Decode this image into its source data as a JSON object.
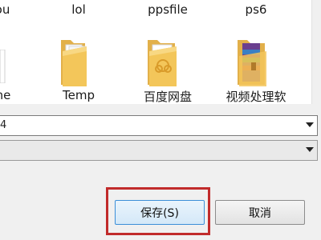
{
  "file_list": {
    "top_row": [
      "ou",
      "lol",
      "ppsfile",
      "ps6"
    ],
    "bottom_row": [
      "he",
      "Temp",
      "百度网盘",
      "视频处理软"
    ]
  },
  "fields": {
    "filename_value": "4",
    "filetype_value": ""
  },
  "buttons": {
    "save_label": "保存(S)",
    "cancel_label": "取消"
  },
  "colors": {
    "highlight": "#c12b2b",
    "folder": "#f3c65a",
    "save_border": "#3c8fd8"
  }
}
